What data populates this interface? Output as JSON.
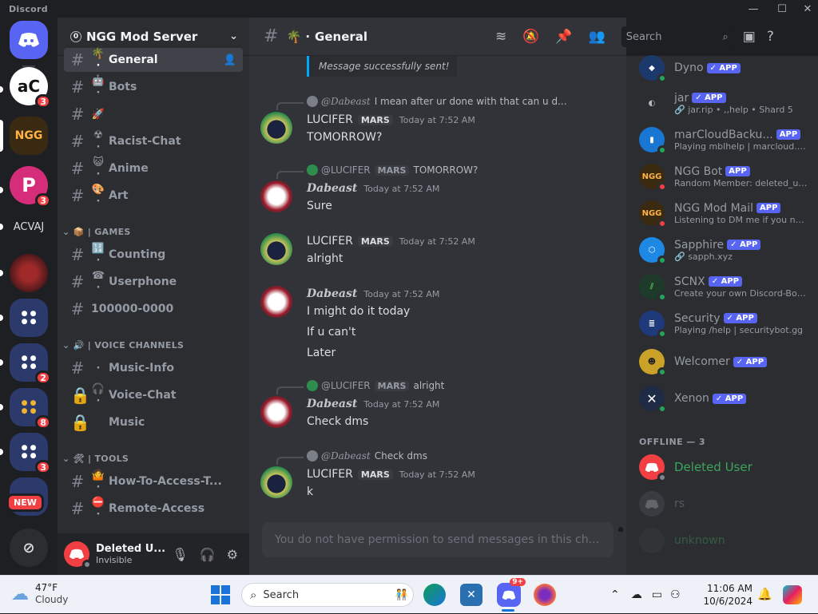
{
  "window": {
    "title": "Discord",
    "controls": [
      "—",
      "☐",
      "✕"
    ]
  },
  "servers": [
    {
      "label": "",
      "badge": "",
      "color": "#5865f2",
      "icon": "discord-home-icon"
    },
    {
      "label": "aC",
      "badge": "3",
      "color": "#ffffff"
    },
    {
      "label": "NGG",
      "badge": "",
      "color": "#3a2a12"
    },
    {
      "label": "P",
      "badge": "3",
      "color": "#d62d7b"
    },
    {
      "label": "ACVAJ",
      "badge": "",
      "color": "#1e1f22"
    },
    {
      "label": "",
      "badge": "",
      "color": "#6b1f23"
    },
    {
      "label": "",
      "badge": "",
      "color": "#2b3a6b"
    },
    {
      "label": "",
      "badge": "2",
      "color": "#2b2d31"
    },
    {
      "label": "",
      "badge": "8",
      "color": "#3b2b2b"
    },
    {
      "label": "",
      "badge": "3",
      "color": "#1f2a45"
    },
    {
      "label": "",
      "badge": "NEW",
      "color": "#2b2d31"
    }
  ],
  "guild": {
    "name": "NGG Mod Server",
    "boost": "0"
  },
  "channels": [
    {
      "name": "General",
      "emoji": "🌴 ·",
      "active": true
    },
    {
      "name": "Bots",
      "emoji": "🤖 ·"
    },
    {
      "name": "",
      "emoji": "🚀"
    },
    {
      "name": "Racist-Chat",
      "emoji": "☢ ·"
    },
    {
      "name": "Anime",
      "emoji": "😺 ·"
    },
    {
      "name": "Art",
      "emoji": "🎨 ·"
    },
    {
      "name": "Counting",
      "emoji": "🔢 ·"
    },
    {
      "name": "Userphone",
      "emoji": "☎ ·"
    },
    {
      "name": "100000-0000",
      "emoji": ""
    },
    {
      "name": "Music-Info",
      "emoji": "·"
    },
    {
      "name": "Voice-Chat",
      "emoji": "🎧 ·"
    },
    {
      "name": "Music",
      "emoji": ""
    },
    {
      "name": "How-To-Access-T...",
      "emoji": "🤷 ·"
    },
    {
      "name": "Remote-Access",
      "emoji": "⛔ ·"
    }
  ],
  "categories": {
    "games": "| GAMES",
    "voice": "| VOICE CHANNELS",
    "tools": "| TOOLS"
  },
  "user": {
    "name": "Deleted U...",
    "status": "Invisible"
  },
  "header": {
    "channel": "General",
    "channel_prefix": "🌴 ·",
    "search_placeholder": "Search"
  },
  "messages": {
    "top_system": "Message successfully sent!",
    "m1": {
      "reply_name": "@Dabeast",
      "reply_text": "I mean after ur done with that can u d...",
      "author": "LUCIFER",
      "tag": "MARS",
      "time": "Today at 7:52 AM",
      "lines": [
        "TOMORROW?"
      ]
    },
    "m2": {
      "reply_name": "@LUCIFER",
      "reply_tag": "MARS",
      "reply_text": "TOMORROW?",
      "author": "Dabeast",
      "time": "Today at 7:52 AM",
      "lines": [
        "Sure"
      ]
    },
    "m3": {
      "author": "LUCIFER",
      "tag": "MARS",
      "time": "Today at 7:52 AM",
      "lines": [
        "alright"
      ]
    },
    "m4": {
      "author": "Dabeast",
      "time": "Today at 7:52 AM",
      "lines": [
        "I might do it today",
        "If u can't",
        "Later"
      ]
    },
    "m5": {
      "reply_name": "@LUCIFER",
      "reply_tag": "MARS",
      "reply_text": "alright",
      "author": "Dabeast",
      "time": "Today at 7:52 AM",
      "lines": [
        "Check dms"
      ]
    },
    "m6": {
      "reply_name": "@Dabeast",
      "reply_text": "Check dms",
      "author": "LUCIFER",
      "tag": "MARS",
      "time": "Today at 7:52 AM",
      "lines": [
        "k"
      ]
    },
    "composer_placeholder": "You do not have permission to send messages in this ch..."
  },
  "members": [
    {
      "name": "Dyno",
      "app": "APP",
      "activity": "",
      "color": "#1b3a6b",
      "status": "#23a55a"
    },
    {
      "name": "jar",
      "app": "APP",
      "activity": "🔗 jar.rip • ,,help • Shard 5",
      "color": "#2b2d31",
      "status": ""
    },
    {
      "name": "marCloudBacku...",
      "app": "APP",
      "activity": "Playing mblhelp | marcloud.n...",
      "color": "#1976d2",
      "status": "#23a55a"
    },
    {
      "name": "NGG Bot",
      "app": "APP",
      "activity": "Random Member: deleted_us...",
      "color": "#3a2a12",
      "status": "#f23f43"
    },
    {
      "name": "NGG Mod Mail",
      "app": "APP",
      "activity": "Listening to DM me if you nee...",
      "color": "#3a2a12",
      "status": "#f23f43"
    },
    {
      "name": "Sapphire",
      "app": "APP",
      "activity": "🔗 sapph.xyz",
      "color": "#1e88e5",
      "status": "#23a55a"
    },
    {
      "name": "SCNX",
      "app": "APP",
      "activity": "Create your own Discord-Bot ...",
      "color": "#1e3a2a",
      "status": "#23a55a"
    },
    {
      "name": "Security",
      "app": "APP",
      "activity": "Playing /help | securitybot.gg",
      "color": "#1e3a7a",
      "status": "#23a55a"
    },
    {
      "name": "Welcomer",
      "app": "APP",
      "activity": "",
      "color": "#c9a227",
      "status": "#23a55a"
    },
    {
      "name": "Xenon",
      "app": "APP",
      "activity": "",
      "color": "#1f2a45",
      "status": "#23a55a"
    }
  ],
  "offline_header": "OFFLINE — 3",
  "offline": [
    {
      "name": "Deleted User",
      "color": "#f23f43",
      "name_color": "#3ba55c"
    },
    {
      "name": "rs",
      "color": "#4e5058",
      "name_color": "#6d6f78"
    },
    {
      "name": "unknown",
      "color": "#3a3c42",
      "name_color": "#3a6b4a"
    }
  ],
  "taskbar": {
    "temp": "47°F",
    "weather": "Cloudy",
    "search": "Search",
    "time": "11:06 AM",
    "date": "10/6/2024",
    "discord_badge": "9+"
  }
}
